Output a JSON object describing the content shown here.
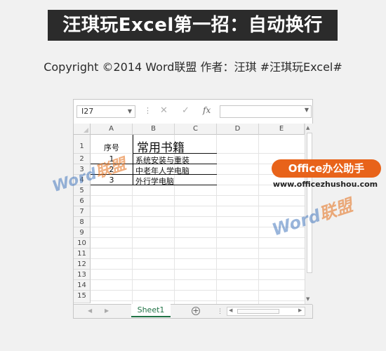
{
  "header": {
    "banner_title": "汪琪玩Excel第一招：自动换行",
    "copyright_line": "Copyright ©2014 Word联盟    作者：汪琪   #汪琪玩Excel#"
  },
  "formula_bar": {
    "name_box_value": "I27",
    "separator_glyph": "⋮",
    "cancel_icon": "✕",
    "enter_icon": "✓",
    "fx_icon": "fx",
    "formula_value": ""
  },
  "grid": {
    "columns": [
      "A",
      "B",
      "C",
      "D",
      "E"
    ],
    "rows": [
      "1",
      "2",
      "3",
      "4",
      "5",
      "6",
      "7",
      "8",
      "9",
      "10",
      "11",
      "12",
      "13",
      "14",
      "15"
    ],
    "cells": {
      "A1": "序号",
      "B1": "常用书籍",
      "A2": "1",
      "B2": "系统安装与重装",
      "A3": "2",
      "B3": "中老年人学电脑",
      "A4": "3",
      "B4": "外行学电脑"
    }
  },
  "sheet_tabs": {
    "active_tab": "Sheet1",
    "add_sheet_icon": "+"
  },
  "watermark": {
    "word_text": "Word",
    "cn_text": "联盟"
  },
  "branding": {
    "badge_text": "Office办公助手",
    "url_text": "www.officezhushou.com",
    "badge_color": "#e8631a"
  },
  "colors": {
    "excel_green": "#217346",
    "banner_bg": "#2b2b2b"
  }
}
